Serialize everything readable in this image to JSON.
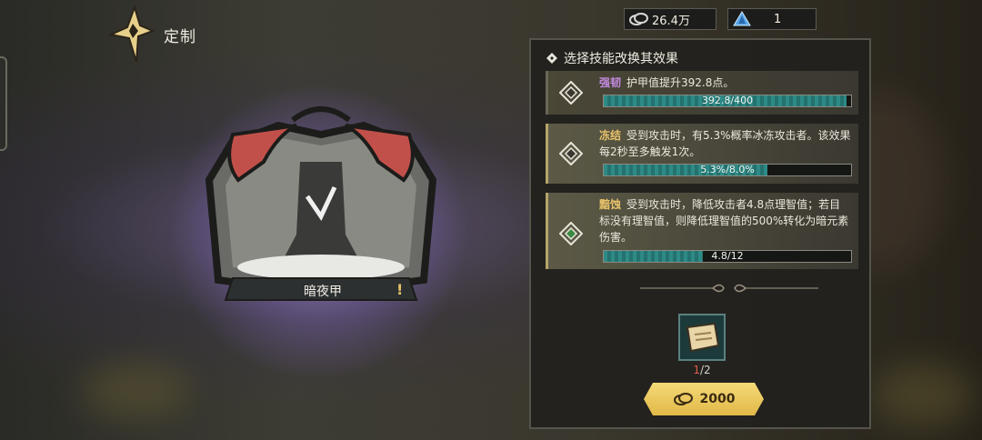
{
  "header": {
    "title": "定制"
  },
  "resources": [
    {
      "icon": "coin-stack-icon",
      "value": "26.4万"
    },
    {
      "icon": "blue-crystal-icon",
      "value": "1"
    }
  ],
  "item": {
    "name": "暗夜甲",
    "warning": "!"
  },
  "panel": {
    "heading": "选择技能改换其效果",
    "skills": [
      {
        "keyword": "强韧",
        "keyword_color": "#c58ae0",
        "text": "护甲值提升392.8点。",
        "bar_label": "392.8/400",
        "progress": 0.982,
        "selected": false
      },
      {
        "keyword": "冻结",
        "keyword_color": "#e8c26a",
        "text": "受到攻击时，有5.3%概率冰冻攻击者。该效果每2秒至多触发1次。",
        "bar_label": "5.3%/8.0%",
        "progress": 0.6625,
        "selected": true
      },
      {
        "keyword": "黯蚀",
        "keyword_color": "#e8c26a",
        "text": "受到攻击时，降低攻击者4.8点理智值；若目标没有理智值，则降低理智值的500%转化为暗元素伤害。",
        "bar_label": "4.8/12",
        "progress": 0.4,
        "selected": true
      }
    ]
  },
  "material": {
    "icon": "scroll-icon",
    "have": "1",
    "need": "2"
  },
  "craft_button": {
    "icon": "coin-stack-icon",
    "cost": "2000"
  }
}
